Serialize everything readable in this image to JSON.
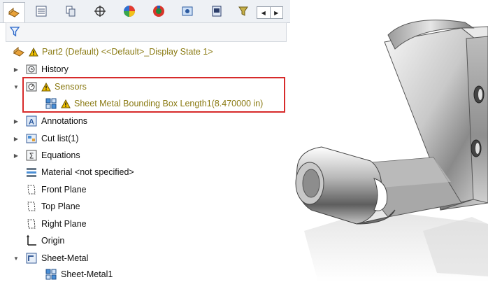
{
  "tabs": [
    {
      "name": "feature-manager-tab",
      "icon": "feature-manager-icon"
    },
    {
      "name": "property-manager-tab",
      "icon": "property-manager-icon"
    },
    {
      "name": "configuration-manager-tab",
      "icon": "configuration-manager-icon"
    },
    {
      "name": "dimxpert-tab",
      "icon": "crosshair-icon"
    },
    {
      "name": "display-manager-tab",
      "icon": "display-manager-icon"
    },
    {
      "name": "cam-tab",
      "icon": "cam-icon"
    },
    {
      "name": "properties-tab",
      "icon": "properties-icon"
    },
    {
      "name": "sim-tab",
      "icon": "sim-icon"
    },
    {
      "name": "extra-tab",
      "icon": "funnel-tab-icon"
    }
  ],
  "tree": {
    "root_label": "Part2 (Default) <<Default>_Display State 1>",
    "history_label": "History",
    "sensors_label": "Sensors",
    "sensor_item_label": "Sheet Metal Bounding Box Length1(8.470000 in)",
    "annotations_label": "Annotations",
    "cutlist_label": "Cut list(1)",
    "equations_label": "Equations",
    "material_label": "Material <not specified>",
    "front_plane_label": "Front Plane",
    "top_plane_label": "Top Plane",
    "right_plane_label": "Right Plane",
    "origin_label": "Origin",
    "sheetmetal_label": "Sheet-Metal",
    "sheetmetal1_label": "Sheet-Metal1"
  },
  "colors": {
    "warning": "#f2c200",
    "highlight_border": "#d72b2b",
    "olive_text": "#8a7a12"
  }
}
